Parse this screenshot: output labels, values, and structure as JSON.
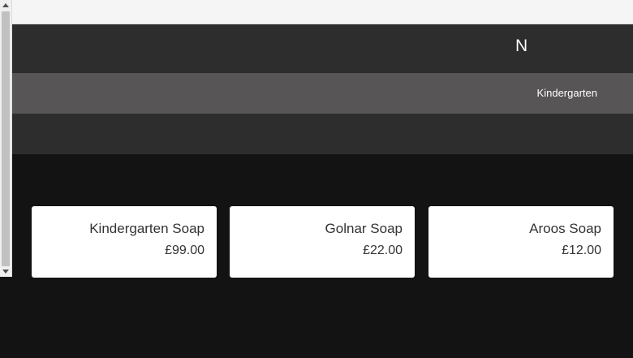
{
  "header": {
    "logo_text": "N"
  },
  "nav": {
    "items": [
      {
        "label": "Kindergarten"
      }
    ]
  },
  "products": [
    {
      "name": "Kindergarten Soap",
      "price": "£99.00"
    },
    {
      "name": "Golnar Soap",
      "price": "£22.00"
    },
    {
      "name": "Aroos Soap",
      "price": "£12.00"
    }
  ],
  "colors": {
    "page_background": "#131313",
    "header_background": "#2d2d2d",
    "nav_background": "#575555",
    "card_background": "#ffffff",
    "text_dark": "#333333"
  },
  "icons": {
    "scroll_up": "triangle-up-icon",
    "scroll_down": "triangle-down-icon"
  }
}
